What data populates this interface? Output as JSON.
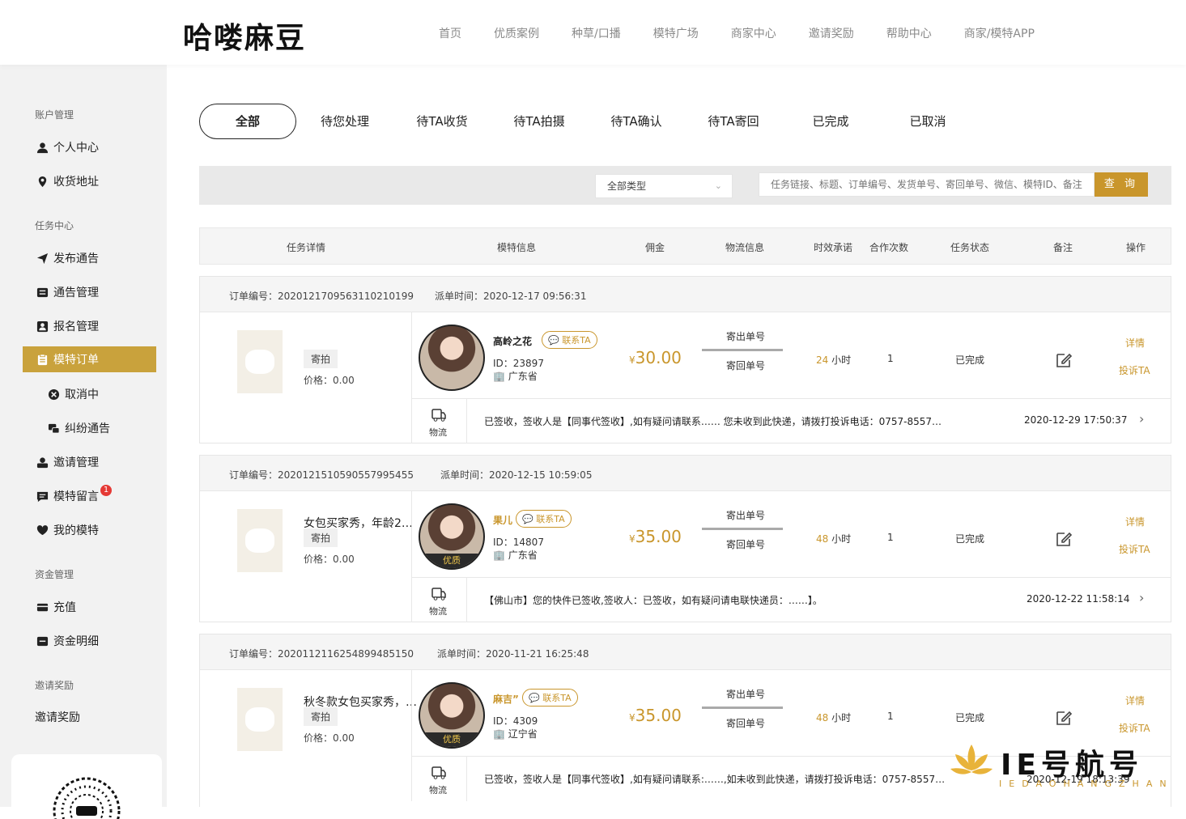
{
  "header": {
    "logo": "哈喽麻豆",
    "nav": [
      "首页",
      "优质案例",
      "种草/口播",
      "模特广场",
      "商家中心",
      "邀请奖励",
      "帮助中心",
      "商家/模特APP"
    ]
  },
  "sidebar": {
    "sections": {
      "account": "账户管理",
      "task": "任务中心",
      "funds": "资金管理",
      "invite": "邀请奖励"
    },
    "items": [
      {
        "label": "个人中心",
        "icon": "user-icon"
      },
      {
        "label": "收货地址",
        "icon": "location-icon"
      },
      {
        "label": "发布通告",
        "icon": "send-icon"
      },
      {
        "label": "通告管理",
        "icon": "list-icon"
      },
      {
        "label": "报名管理",
        "icon": "person-card-icon"
      },
      {
        "label": "模特订单",
        "icon": "order-icon"
      },
      {
        "label": "取消中",
        "icon": "cancel-circle-icon"
      },
      {
        "label": "纠纷通告",
        "icon": "dispute-icon"
      },
      {
        "label": "邀请管理",
        "icon": "invite-icon"
      },
      {
        "label": "模特留言",
        "icon": "message-icon",
        "badge": "1"
      },
      {
        "label": "我的模特",
        "icon": "heart-icon"
      },
      {
        "label": "充值",
        "icon": "card-icon"
      },
      {
        "label": "资金明细",
        "icon": "ledger-icon"
      },
      {
        "label": "邀请奖励",
        "icon": ""
      }
    ]
  },
  "tabs": [
    "全部",
    "待您处理",
    "待TA收货",
    "待TA拍摄",
    "待TA确认",
    "待TA寄回",
    "已完成",
    "已取消"
  ],
  "filter": {
    "type_select": "全部类型",
    "search_placeholder": "任务链接、标题、订单编号、发货单号、寄回单号、微信、模特ID、备注",
    "search_button": "查 询"
  },
  "columns": [
    "任务详情",
    "模特信息",
    "佣金",
    "物流信息",
    "时效承诺",
    "合作次数",
    "任务状态",
    "备注",
    "操作"
  ],
  "orders": [
    {
      "order_no": "订单编号：2020121709563110210199",
      "dispatch_time": "派单时间：2020-12-17 09:56:31",
      "title": "",
      "tag": "寄拍",
      "price": "价格：0.00",
      "model_name": "高岭之花",
      "contact": "联系TA",
      "model_id": "ID：23897",
      "province": "广东省",
      "premium": "",
      "fee_symbol": "¥",
      "fee": "30.00",
      "ship_out": "寄出单号",
      "ship_back": "寄回单号",
      "hours": "24",
      "hours_unit": "小时",
      "coop_count": "1",
      "status": "已完成",
      "detail": "详情",
      "complain": "投诉TA",
      "logistics_label": "物流",
      "track": "已签收，签收人是【同事代签收】,如有疑问请联系…… 您未收到此快递，请拨打投诉电话：0757-8557…",
      "track_time": "2020-12-29 17:50:37"
    },
    {
      "order_no": "订单编号：2020121510590557995455",
      "dispatch_time": "派单时间：2020-12-15 10:59:05",
      "title": "女包买家秀，年龄25…",
      "tag": "寄拍",
      "price": "价格：0.00",
      "model_name": "果儿",
      "contact": "联系TA",
      "model_id": "ID：14807",
      "province": "广东省",
      "premium": "优质",
      "fee_symbol": "¥",
      "fee": "35.00",
      "ship_out": "寄出单号",
      "ship_back": "寄回单号",
      "hours": "48",
      "hours_unit": "小时",
      "coop_count": "1",
      "status": "已完成",
      "detail": "详情",
      "complain": "投诉TA",
      "logistics_label": "物流",
      "track": "【佛山市】您的快件已签收,签收人：已签收，如有疑问请电联快递员：……】。",
      "track_time": "2020-12-22 11:58:14"
    },
    {
      "order_no": "订单编号：2020112116254899485150",
      "dispatch_time": "派单时间：2020-11-21 16:25:48",
      "title": "秋冬款女包买家秀，…",
      "tag": "寄拍",
      "price": "价格：0.00",
      "model_name": "麻吉”",
      "contact": "联系TA",
      "model_id": "ID：4309",
      "province": "辽宁省",
      "premium": "优质",
      "fee_symbol": "¥",
      "fee": "35.00",
      "ship_out": "寄出单号",
      "ship_back": "寄回单号",
      "hours": "48",
      "hours_unit": "小时",
      "coop_count": "1",
      "status": "已完成",
      "detail": "详情",
      "complain": "投诉TA",
      "logistics_label": "物流",
      "track": "已签收，签收人是【同事代签收】,如有疑问请联系:……,如未收到此快递，请拨打投诉电话：0757-8557…",
      "track_time": "2020-12-19 18:13:39"
    }
  ],
  "watermark": {
    "title": "IE号航号",
    "subtitle": "IEDAOHANGZHAN"
  },
  "colors": {
    "accent": "#c9962c",
    "sidebar_active": "#c9a23c"
  }
}
